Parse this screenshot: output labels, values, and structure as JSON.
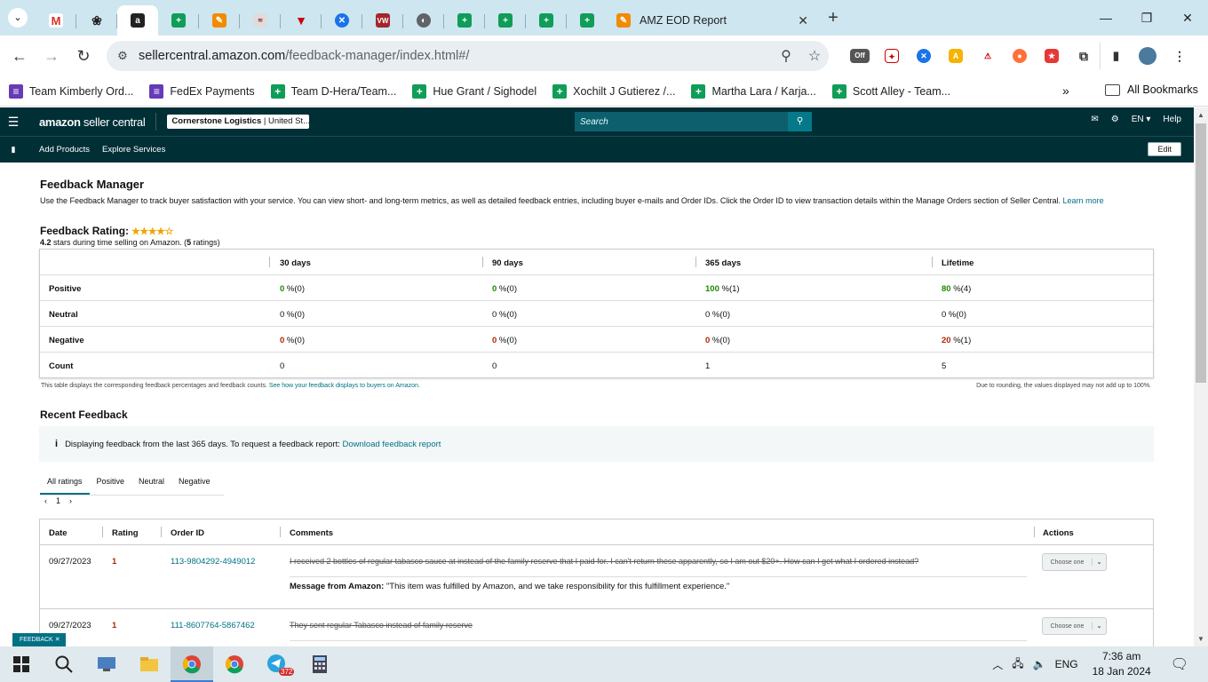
{
  "browser": {
    "active_tab_title": "AMZ EOD Report",
    "url_host": "sellercentral.amazon.com",
    "url_path": "/feedback-manager/index.html#/",
    "mini_tab_icons": [
      "gmail-icon",
      "chatgpt-icon",
      "amazon-icon",
      "sheets-icon",
      "app-icon",
      "app-icon",
      "app-icon",
      "app-icon",
      "vw-icon",
      "globe-icon",
      "sheets-icon",
      "sheets-icon",
      "sheets-icon",
      "sheets-icon"
    ],
    "bookmarks": [
      {
        "label": "Team Kimberly Ord...",
        "color": "#673ab7"
      },
      {
        "label": "FedEx Payments",
        "color": "#673ab7"
      },
      {
        "label": "Team D-Hera/Team...",
        "color": "#0f9d58"
      },
      {
        "label": "Hue Grant / Sighodel",
        "color": "#0f9d58"
      },
      {
        "label": "Xochilt J Gutierez /...",
        "color": "#0f9d58"
      },
      {
        "label": "Martha Lara / Karja...",
        "color": "#0f9d58"
      },
      {
        "label": "Scott Alley - Team...",
        "color": "#0f9d58"
      }
    ],
    "all_bookmarks": "All Bookmarks",
    "ext_off_label": "Off"
  },
  "seller_central": {
    "logo_bold": "amazon",
    "logo_rest": " seller central",
    "store_name": "Cornerstone Logistics",
    "store_region": " | United St...",
    "search_placeholder": "Search",
    "lang": "EN ▾",
    "help": "Help",
    "nav_items": [
      "Add Products",
      "Explore Services"
    ],
    "edit": "Edit"
  },
  "page": {
    "title": "Feedback Manager",
    "description": "Use the Feedback Manager to track buyer satisfaction with your service. You can view short- and long-term metrics, as well as detailed feedback entries, including buyer e-mails and Order IDs. Click the Order ID to view transaction details within the Manage Orders section of Seller Central.",
    "learn_more": "Learn more",
    "rating_label": "Feedback Rating:",
    "stars": "★★★★☆",
    "rating_value": "4.2",
    "rating_text": " stars during time selling on Amazon. (",
    "rating_count": "5",
    "rating_suffix": " ratings)",
    "periods": [
      "30 days",
      "90 days",
      "365 days",
      "Lifetime"
    ],
    "rows": [
      {
        "label": "Positive",
        "vals": [
          {
            "n": "0",
            "s": " %(0)"
          },
          {
            "n": "0",
            "s": " %(0)"
          },
          {
            "n": "100",
            "s": " %(1)"
          },
          {
            "n": "80",
            "s": " %(4)"
          }
        ]
      },
      {
        "label": "Neutral",
        "vals": [
          {
            "n": "0",
            "s": " %(0)"
          },
          {
            "n": "0",
            "s": " %(0)"
          },
          {
            "n": "0",
            "s": " %(0)"
          },
          {
            "n": "0",
            "s": " %(0)"
          }
        ]
      },
      {
        "label": "Negative",
        "vals": [
          {
            "n": "0",
            "s": " %(0)"
          },
          {
            "n": "0",
            "s": " %(0)"
          },
          {
            "n": "0",
            "s": " %(0)"
          },
          {
            "n": "20",
            "s": " %(1)"
          }
        ]
      },
      {
        "label": "Count",
        "vals": [
          {
            "n": "0",
            "s": ""
          },
          {
            "n": "0",
            "s": ""
          },
          {
            "n": "1",
            "s": ""
          },
          {
            "n": "5",
            "s": ""
          }
        ]
      }
    ],
    "note_left": "This table displays the corresponding feedback percentages and feedback counts.",
    "note_link": "See how your feedback displays to buyers on Amazon.",
    "note_right": "Due to rounding, the values displayed may not add up to 100%.",
    "recent_title": "Recent Feedback",
    "info_text": "Displaying feedback from the last 365 days. To request a feedback report:",
    "info_link": "Download feedback report",
    "filter_tabs": [
      "All ratings",
      "Positive",
      "Neutral",
      "Negative"
    ],
    "page_num": "1",
    "cols": [
      "Date",
      "Rating",
      "Order ID",
      "Comments",
      "Actions"
    ],
    "feedback": [
      {
        "date": "09/27/2023",
        "rating": "1",
        "order": "113-9804292-4949012",
        "comment": "I received 2 bottles of regular tabasco sauce at instead of the family reserve that I paid for. I can't return these apparently, so I am out $20+. How can I get what I ordered instead?",
        "msg_label": "Message from Amazon:",
        "msg": " \"This item was fulfilled by Amazon, and we take responsibility for this fulfillment experience.\"",
        "action": "Choose one"
      },
      {
        "date": "09/27/2023",
        "rating": "1",
        "order": "111-8607764-5867462",
        "comment": "They sent regular Tabasco instead of family reserve",
        "action": "Choose one"
      }
    ],
    "feedback_tab": "FEEDBACK"
  },
  "taskbar": {
    "lang": "ENG",
    "time": "7:36 am",
    "date": "18 Jan 2024",
    "telegram_badge": "372"
  }
}
